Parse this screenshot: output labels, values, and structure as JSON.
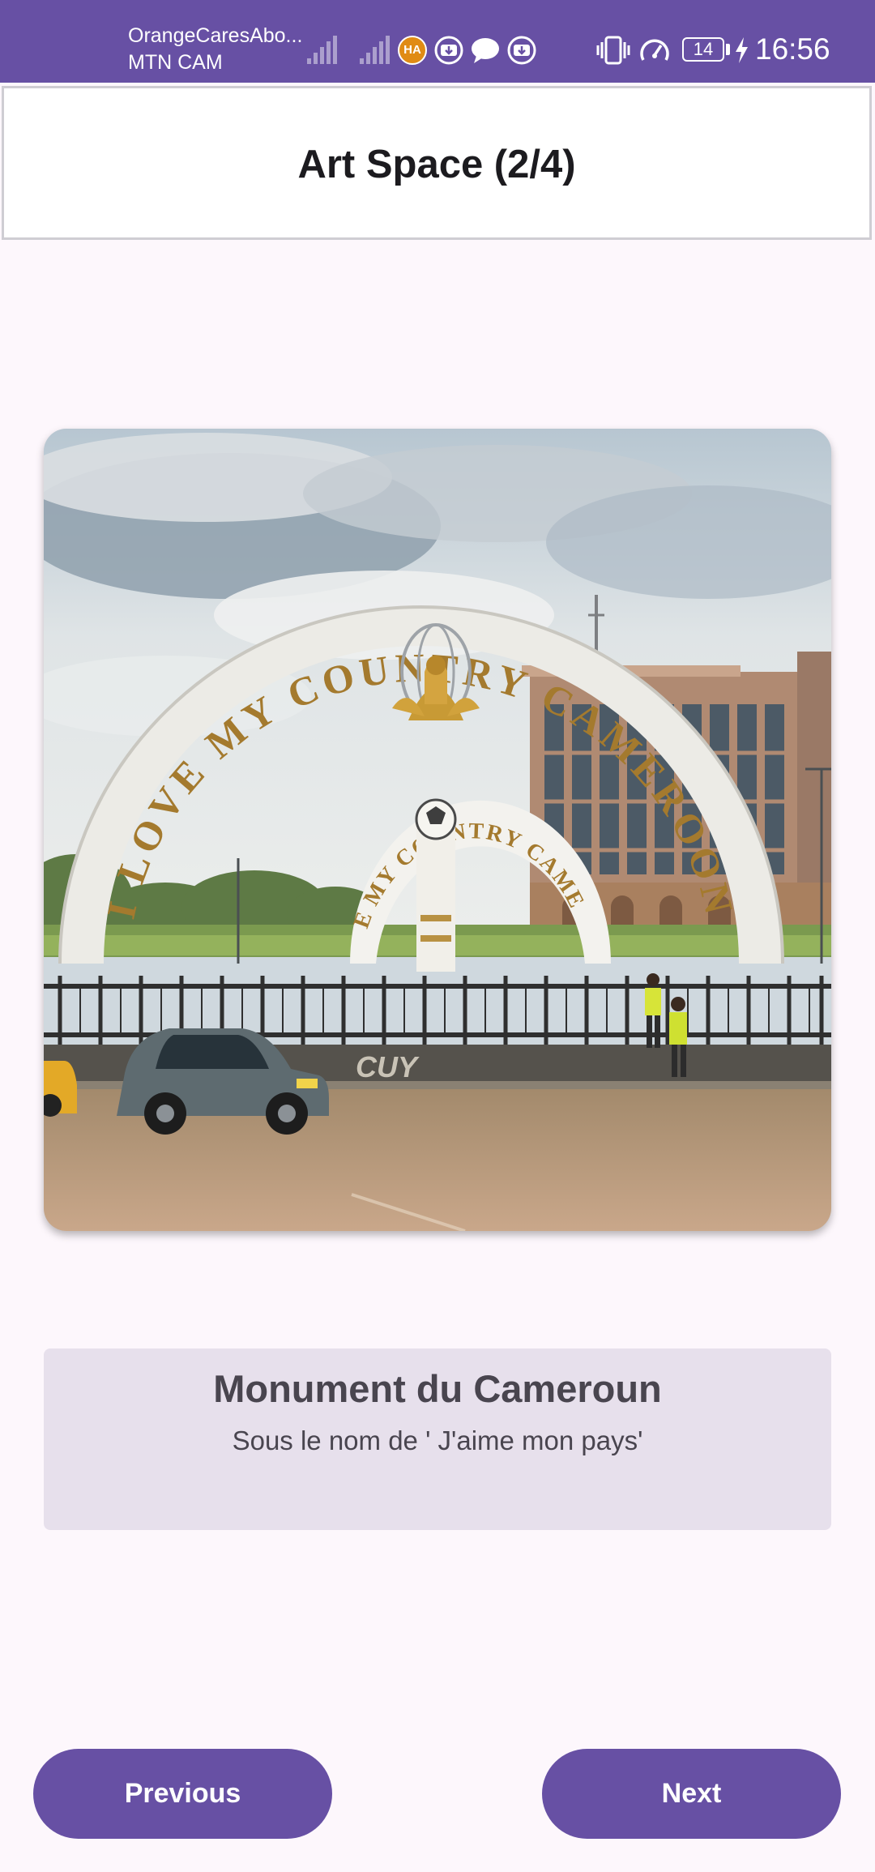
{
  "status_bar": {
    "carrier_primary": "OrangeCaresAbo...",
    "carrier_secondary": "MTN CAM",
    "notification_badge": "HA",
    "battery_level": "14",
    "time": "16:56",
    "icons": [
      "signal-icon",
      "signal-icon",
      "ha-notification-icon",
      "download-icon",
      "chat-icon",
      "download-icon",
      "vibrate-icon",
      "speed-icon",
      "battery-icon",
      "charging-icon"
    ],
    "background_color": "#6750a4"
  },
  "header": {
    "title": "Art Space (2/4)"
  },
  "artwork": {
    "arch_text_outer": "I LOVE MY COUNTRY CAMEROON",
    "arch_text_inner": "I LOVE MY COUNTRY CAMEROON",
    "ground_text": "CUY"
  },
  "caption": {
    "title": "Monument du Cameroun",
    "subtitle": "Sous le nom de ' J'aime mon pays'"
  },
  "buttons": {
    "previous": "Previous",
    "next": "Next",
    "color": "#6750a4"
  }
}
